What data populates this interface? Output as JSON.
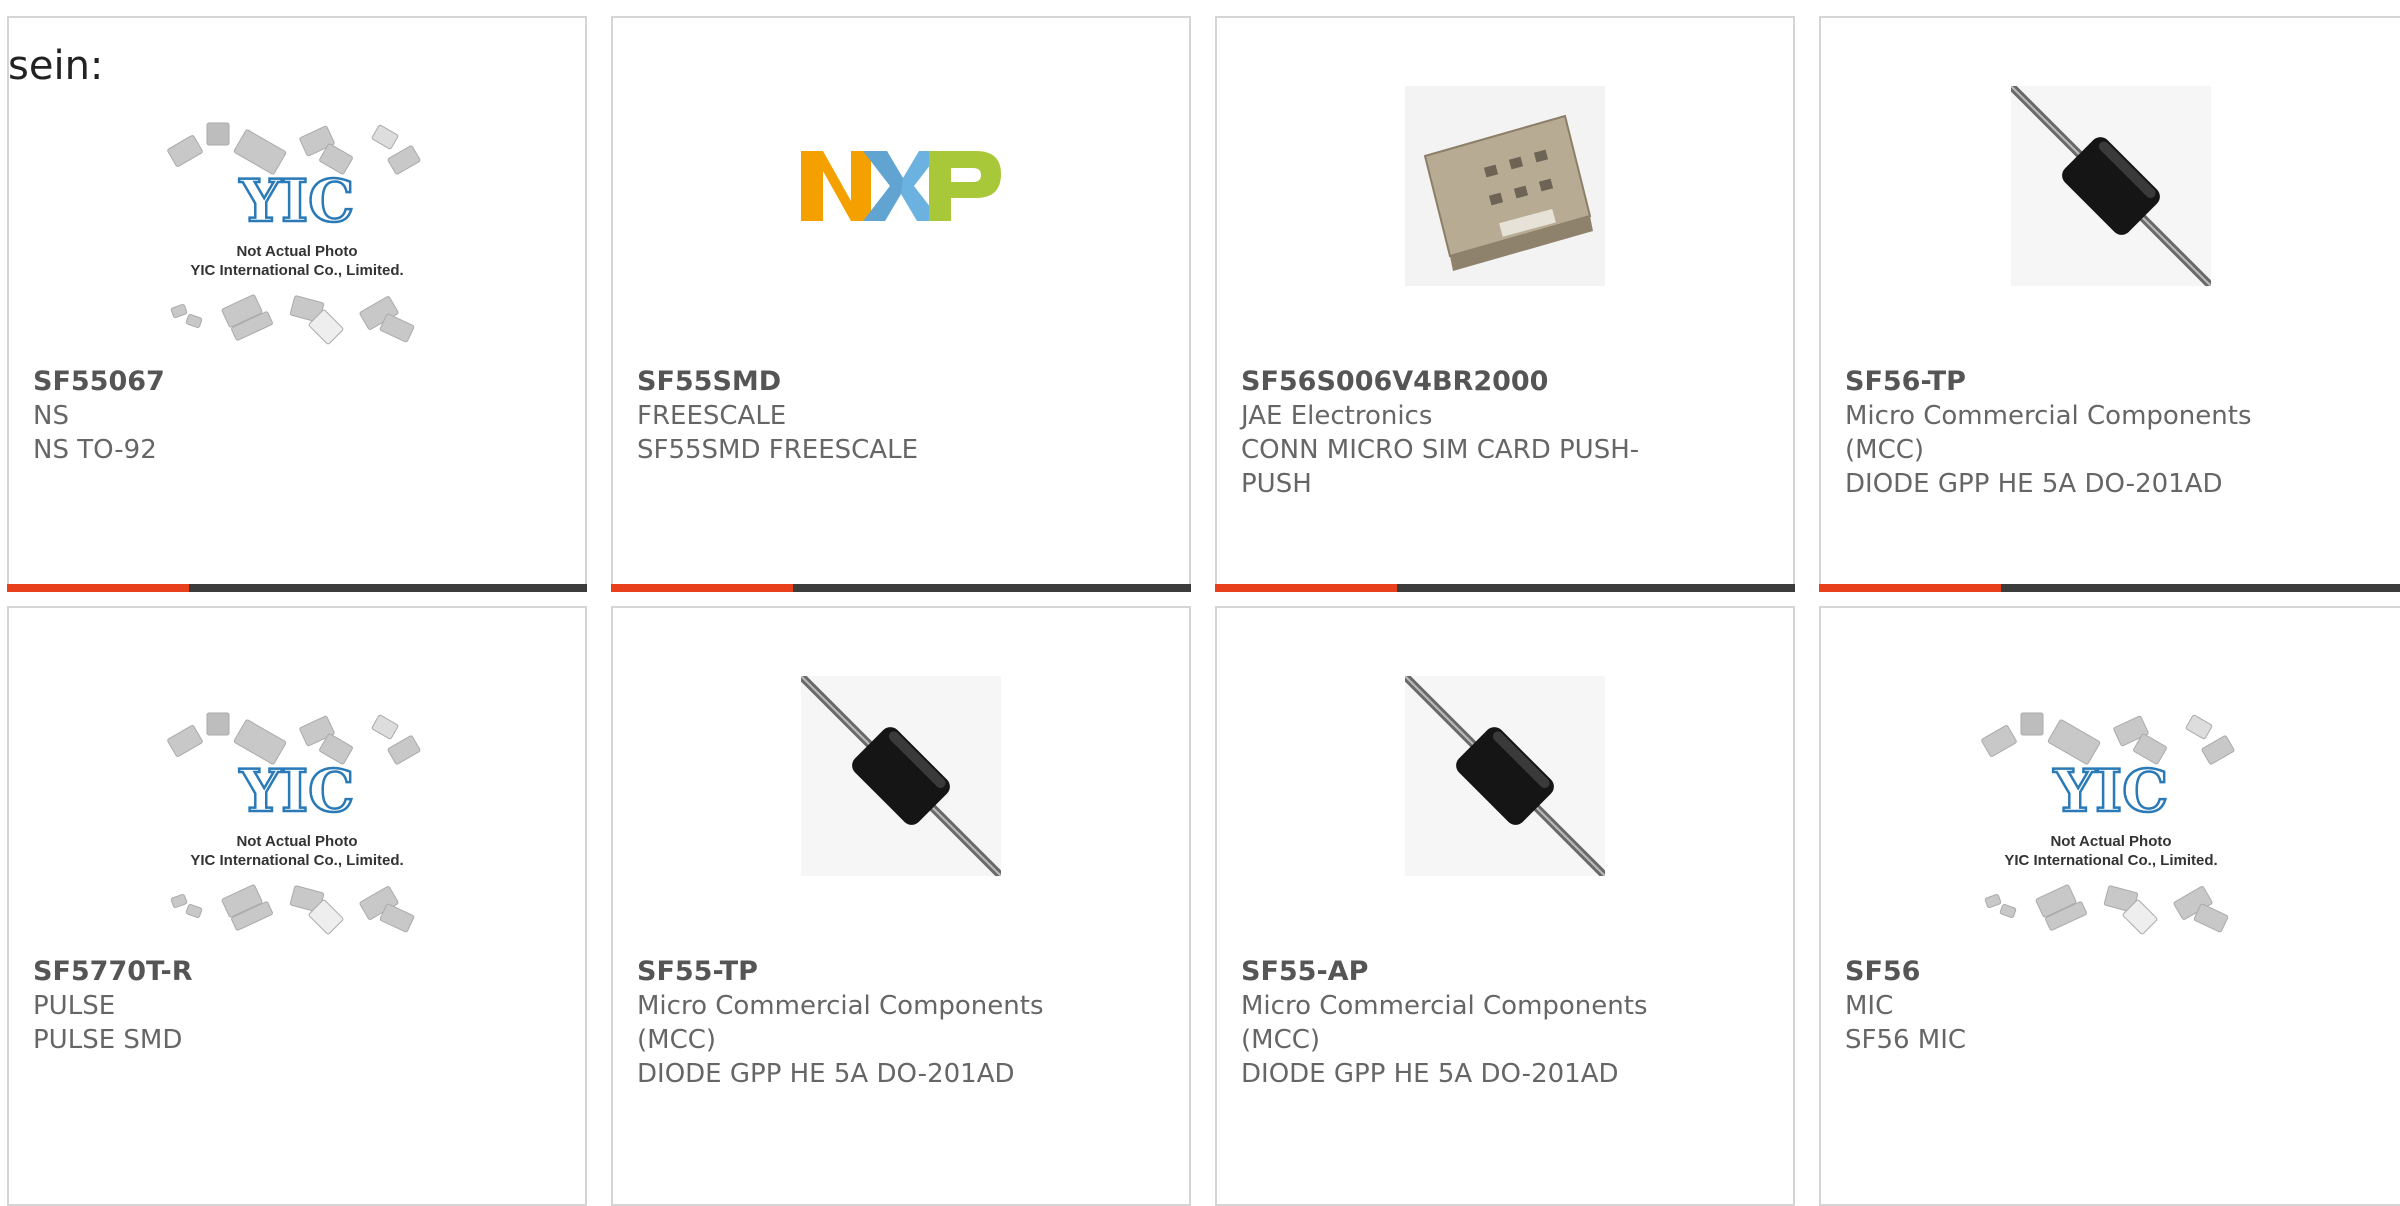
{
  "intro_text": "sein:",
  "colors": {
    "accent": "#e8401c",
    "bar": "#3c3c3c",
    "border": "#d5d5d5",
    "yic_blue": "#2a7ab8"
  },
  "placeholder": {
    "line1": "Not Actual Photo",
    "line2": "YIC International Co., Limited.",
    "logo": "YIC"
  },
  "products": [
    {
      "part": "SF55067",
      "manufacturer": "NS",
      "description": "NS TO-92",
      "image": "placeholder"
    },
    {
      "part": "SF55SMD",
      "manufacturer": "FREESCALE",
      "description": "SF55SMD FREESCALE",
      "image": "nxp-logo"
    },
    {
      "part": "SF56S006V4BR2000",
      "manufacturer": "JAE Electronics",
      "description": "CONN MICRO SIM CARD PUSH-PUSH",
      "image": "sim-connector"
    },
    {
      "part": "SF56-TP",
      "manufacturer": "Micro Commercial Components (MCC)",
      "description": "DIODE GPP HE 5A DO-201AD",
      "image": "diode"
    },
    {
      "part": "SF5770T-R",
      "manufacturer": "PULSE",
      "description": "PULSE SMD",
      "image": "placeholder"
    },
    {
      "part": "SF55-TP",
      "manufacturer": "Micro Commercial Components (MCC)",
      "description": "DIODE GPP HE 5A DO-201AD",
      "image": "diode"
    },
    {
      "part": "SF55-AP",
      "manufacturer": "Micro Commercial Components (MCC)",
      "description": "DIODE GPP HE 5A DO-201AD",
      "image": "diode"
    },
    {
      "part": "SF56",
      "manufacturer": "MIC",
      "description": "SF56 MIC",
      "image": "placeholder"
    }
  ]
}
